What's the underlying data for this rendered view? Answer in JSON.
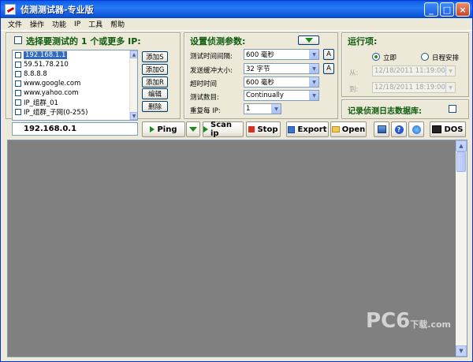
{
  "window": {
    "title": "侦测测试器-专业版"
  },
  "menu": [
    "文件",
    "操作",
    "功能",
    "IP",
    "工具",
    "帮助"
  ],
  "ip_panel": {
    "title": "选择要测试的 1 个或更多 IP:",
    "items": [
      "192.168.1.1",
      "59.51.78.210",
      "8.8.8.8",
      "www.google.com",
      "www.yahoo.com",
      "IP_组群_01",
      "IP_组群_子网(0-255)"
    ],
    "buttons": [
      "添加S",
      "添加G",
      "添加R",
      "编辑",
      "删除"
    ]
  },
  "params": {
    "title": "设置侦测参数:",
    "rows": [
      {
        "label": "测试时间间隔:",
        "value": "600 毫秒",
        "extra": "A"
      },
      {
        "label": "发送缓冲大小:",
        "value": "32 字节",
        "extra": "A"
      },
      {
        "label": "超时时间",
        "value": "600 毫秒"
      },
      {
        "label": "测试数目:",
        "value": "Continually"
      },
      {
        "label": "重复每 IP:",
        "value": "1"
      }
    ]
  },
  "run": {
    "title": "运行项:",
    "now_label": "立即",
    "schedule_label": "日程安排",
    "from_label": "从:",
    "to_label": "到:",
    "from_value": "12/18/2011 11:19:00",
    "to_value": "12/18/2011 18:19:00",
    "log_label": "记录侦测日志数据库:"
  },
  "toolbar": {
    "ip_value": "192.168.0.1",
    "ping": "Ping",
    "scan": "Scan ip",
    "stop": "Stop",
    "export": "Export",
    "open": "Open",
    "dos": "DOS"
  },
  "watermark": {
    "main": "PC6",
    "sub": "下载",
    "domain": ".com"
  },
  "colors": {
    "title_green": "#0b5b0b",
    "titlebar": "#0a5fe6",
    "output_bg": "#808080"
  }
}
